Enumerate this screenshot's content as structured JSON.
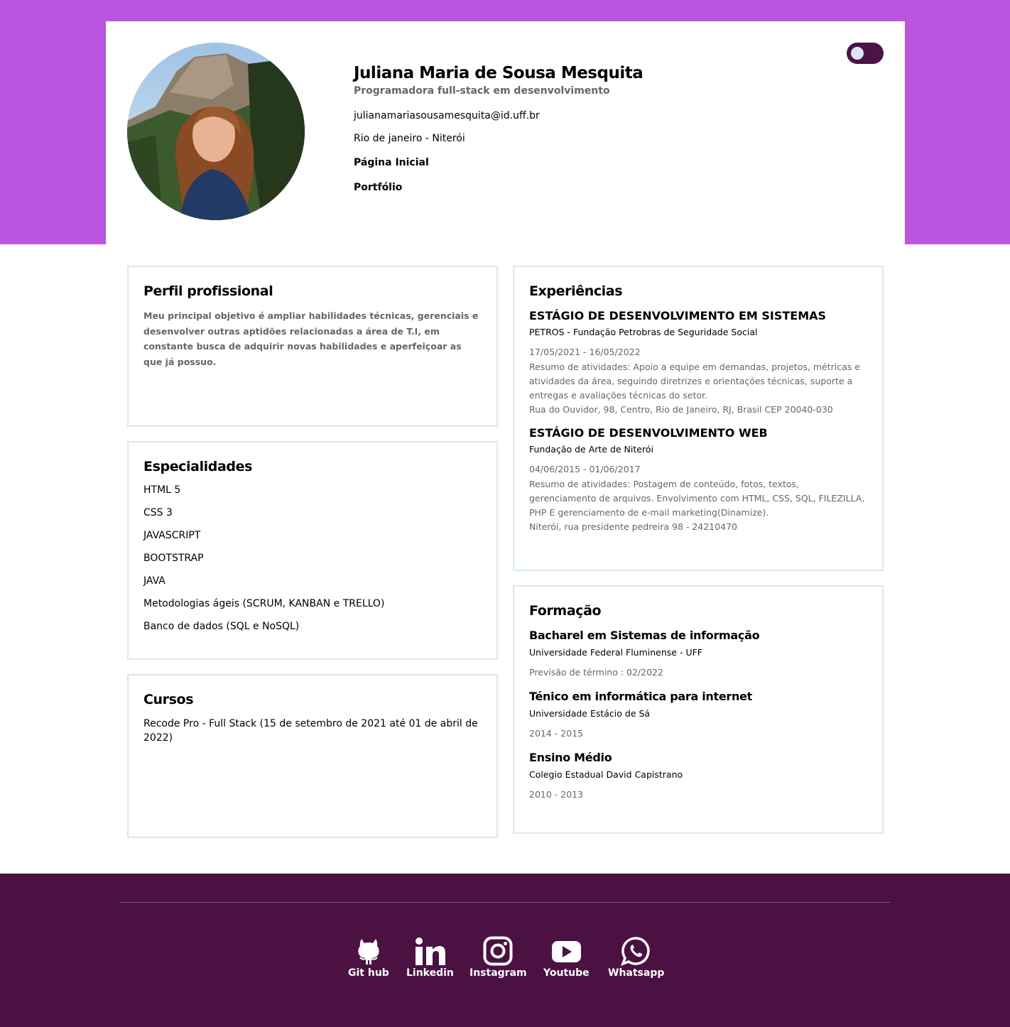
{
  "header": {
    "name": "Juliana Maria de Sousa Mesquita",
    "role": "Programadora full-stack em desenvolvimento",
    "email": "julianamariasousamesquita@id.uff.br",
    "location": "Rio de janeiro - Niterói",
    "links": [
      "Página Inicial",
      "Portfólio"
    ]
  },
  "theme_toggle": {
    "state": "off",
    "color": "#4b1445"
  },
  "colors": {
    "accent": "#bb55e0",
    "footer": "#4b1142",
    "border": "#d6e8f5"
  },
  "perfil": {
    "title": "Perfil profissional",
    "text": "Meu principal objetivo é ampliar habilidades técnicas, gerenciais e desenvolver outras aptidões relacionadas a área de T.I, em constante busca de adquirir novas habilidades e aperfeiçoar as que já possuo."
  },
  "especialidades": {
    "title": "Especialidades",
    "items": [
      "HTML 5",
      "CSS 3",
      "JAVASCRIPT",
      "BOOTSTRAP",
      "JAVA",
      "Metodologias ágeis (SCRUM, KANBAN e TRELLO)",
      "Banco de dados (SQL e NoSQL)"
    ]
  },
  "cursos": {
    "title": "Cursos",
    "items": [
      "Recode Pro - Full Stack (15 de setembro de 2021 até 01 de abril de 2022)"
    ]
  },
  "experiencias": {
    "title": "Experiências",
    "items": [
      {
        "title": "ESTÁGIO DE DESENVOLVIMENTO EM SISTEMAS",
        "org": "PETROS - Fundação Petrobras de Seguridade Social",
        "date": "17/05/2021 - 16/05/2022",
        "desc": "Resumo de atividades: Apoio a equipe em demandas, projetos, métricas e atividades da área, seguindo diretrizes e orientações técnicas, suporte a entregas e avaliações técnicas do setor.",
        "address": "Rua do Ouvidor, 98, Centro, Rio de Janeiro, RJ, Brasil CEP 20040-030"
      },
      {
        "title": "ESTÁGIO DE DESENVOLVIMENTO WEB",
        "org": "Fundação de Arte de Niterói",
        "date": "04/06/2015 - 01/06/2017",
        "desc": "Resumo de atividades: Postagem de conteúdo, fotos, textos, gerenciamento de arquivos. Envolvimento com HTML, CSS, SQL, FILEZILLA, PHP E gerenciamento de e-mail marketing(Dinamize).",
        "address": "Niterói, rua presidente pedreira 98 - 24210470"
      }
    ]
  },
  "formacao": {
    "title": "Formação",
    "items": [
      {
        "title": "Bacharel em Sistemas de informação",
        "org": "Universidade Federal Fluminense - UFF",
        "date": "Previsão de término : 02/2022"
      },
      {
        "title": "Ténico em informática para internet",
        "org": "Universidade Estácio de Sá",
        "date": "2014 - 2015"
      },
      {
        "title": "Ensino Médio",
        "org": "Colegio Estadual David Capistrano",
        "date": "2010 - 2013"
      }
    ]
  },
  "footer": {
    "social": [
      {
        "label": "Git hub",
        "icon": "github-icon"
      },
      {
        "label": "Linkedin",
        "icon": "linkedin-icon"
      },
      {
        "label": "Instagram",
        "icon": "instagram-icon"
      },
      {
        "label": "Youtube",
        "icon": "youtube-icon"
      },
      {
        "label": "Whatsapp",
        "icon": "whatsapp-icon"
      }
    ]
  }
}
